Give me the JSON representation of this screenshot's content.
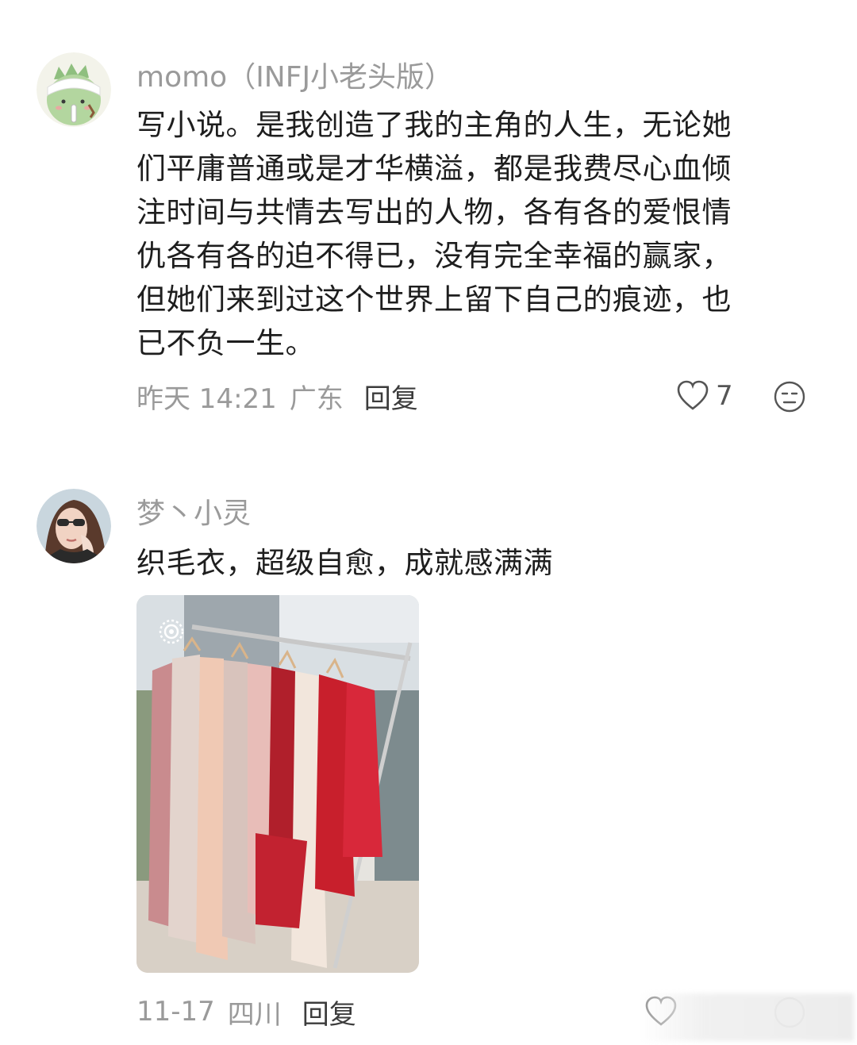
{
  "comments": [
    {
      "username": "momo（INFJ小老头版）",
      "body_lines": [
        "写小说。是我创造了我的主角的人生，无论她",
        "们平庸普通或是才华横溢，都是我费尽心血倾",
        "注时间与共情去写出的人物，各有各的爱恨情",
        "仇各有各的迫不得已，没有完全幸福的赢家，",
        "但她们来到过这个世界上留下自己的痕迹，也",
        "已不负一生。"
      ],
      "time": "昨天 14:21",
      "location": "广东",
      "reply_label": "回复",
      "like_count": "7",
      "avatar_icon": "dinosaur-avatar",
      "accent_color": "#a9cf9c"
    },
    {
      "username": "梦丶小灵",
      "body_lines": [
        "织毛衣，超级自愈，成就感满满"
      ],
      "time": "11-17",
      "location": "四川",
      "reply_label": "回复",
      "like_count": "",
      "avatar_icon": "woman-portrait-avatar",
      "photo_icon": "clothing-rack-photo"
    }
  ]
}
